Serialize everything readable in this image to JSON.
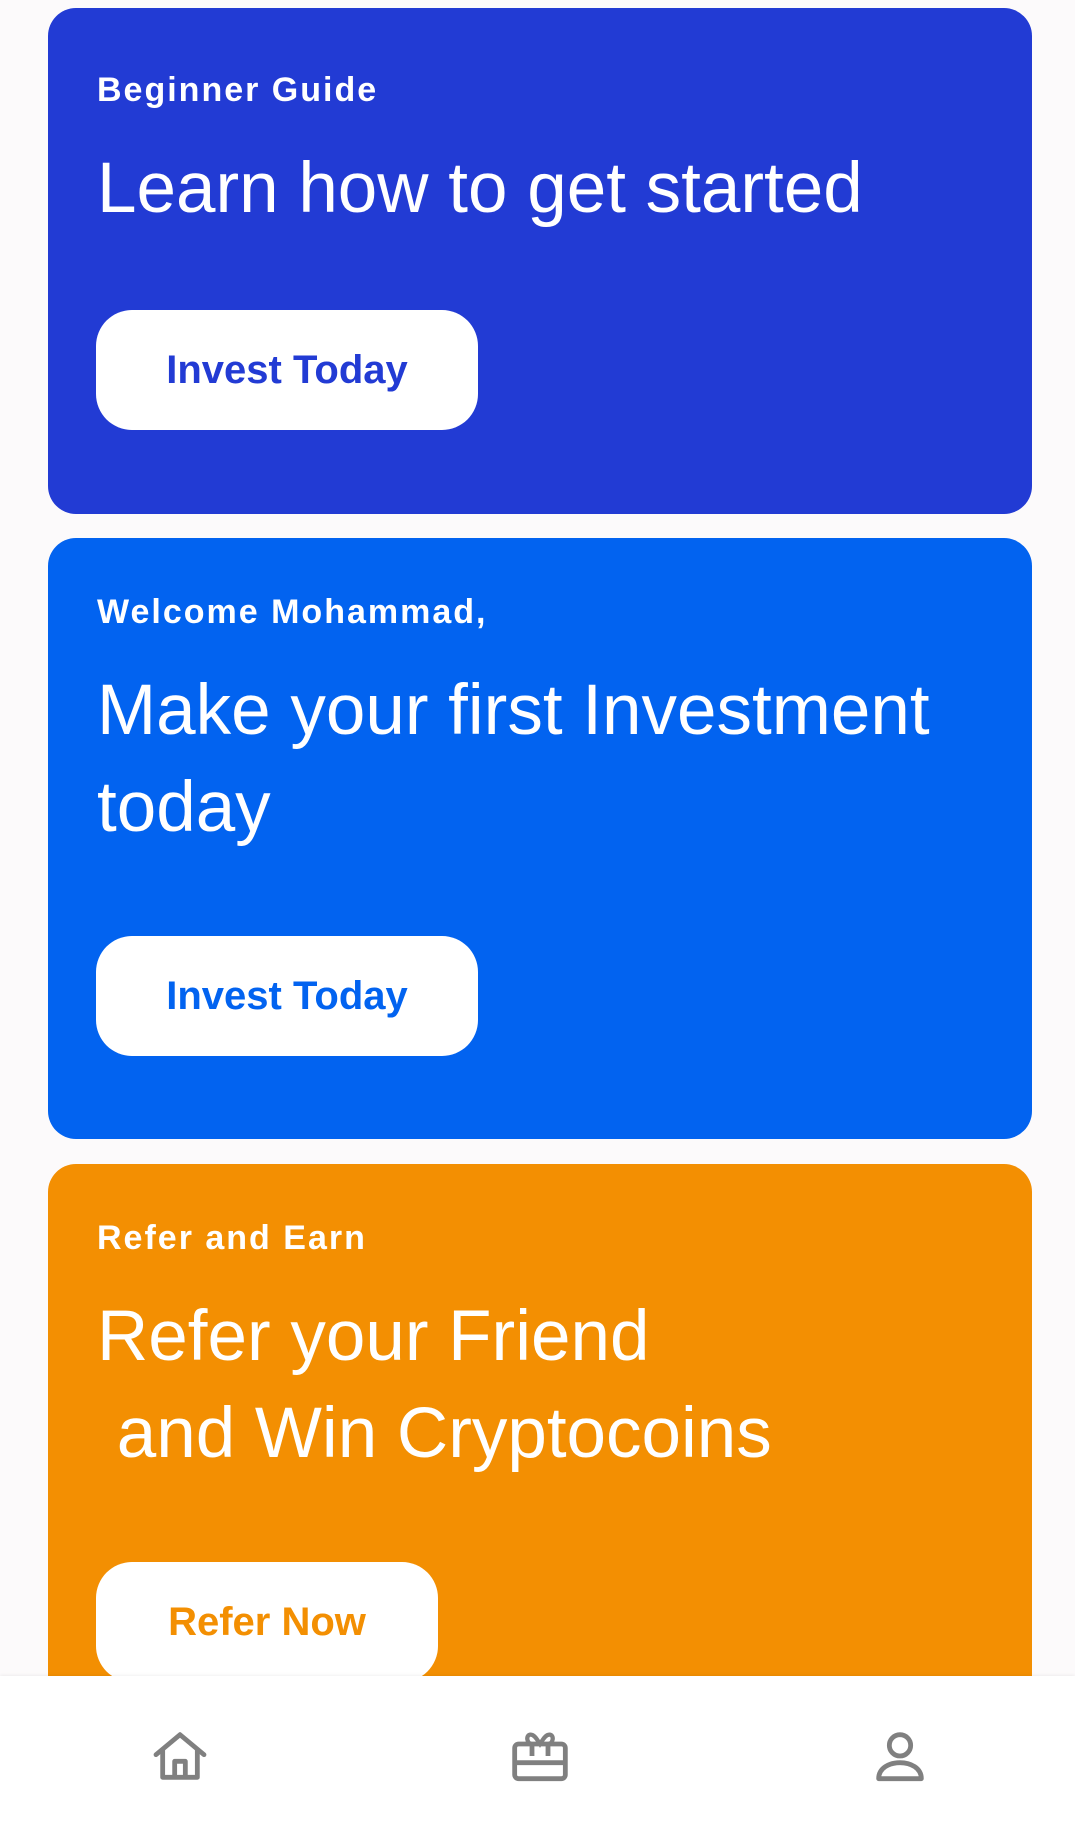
{
  "cards": [
    {
      "eyebrow": "Beginner Guide",
      "headline": "Learn how to get started",
      "button_label": "Invest Today",
      "color": "#223bd4"
    },
    {
      "eyebrow": "Welcome Mohammad,",
      "headline": "Make your first Investment today",
      "button_label": "Invest Today",
      "color": "#0263f0"
    },
    {
      "eyebrow": "Refer and Earn",
      "headline": "Refer your Friend\n and Win Cryptocoins",
      "button_label": "Refer Now",
      "color": "#f38f02"
    }
  ],
  "bottom_nav": {
    "items": [
      {
        "icon": "home-icon"
      },
      {
        "icon": "gift-icon"
      },
      {
        "icon": "profile-icon"
      }
    ],
    "icon_color": "#808080"
  }
}
